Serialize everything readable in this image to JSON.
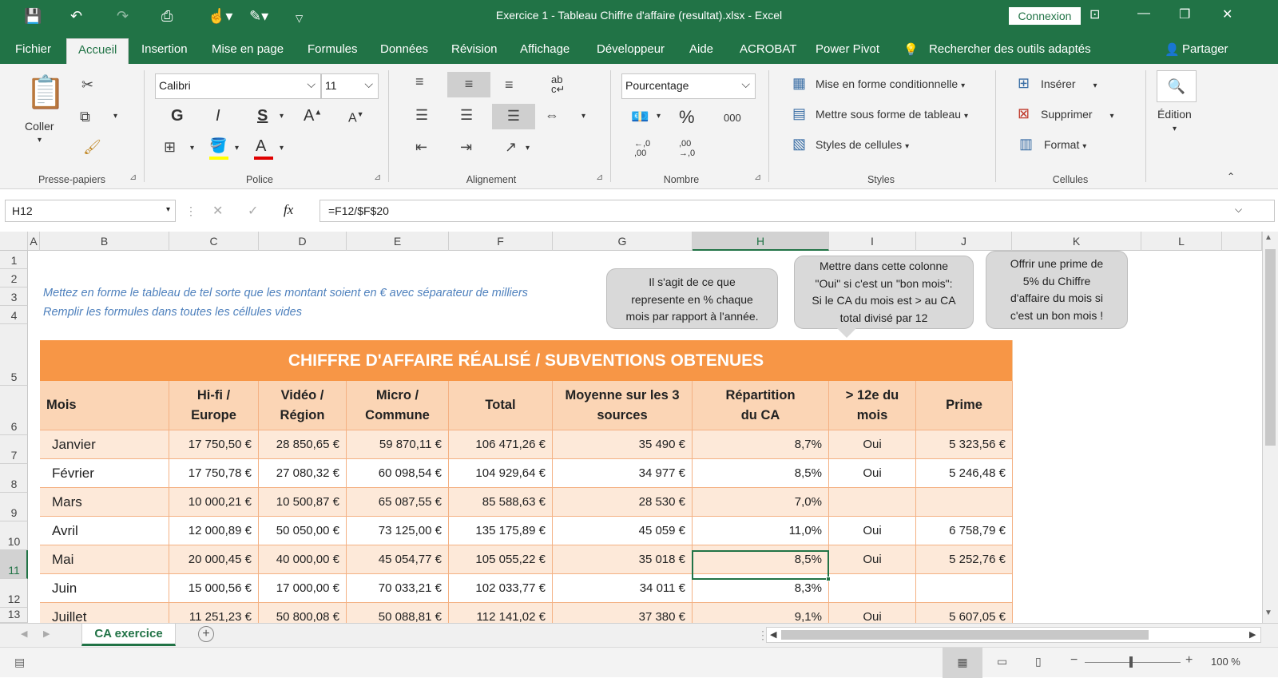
{
  "window": {
    "title": "Exercice 1 - Tableau Chiffre d'affaire (resultat).xlsx  -  Excel",
    "connexion": "Connexion"
  },
  "tabs": [
    "Fichier",
    "Accueil",
    "Insertion",
    "Mise en page",
    "Formules",
    "Données",
    "Révision",
    "Affichage",
    "Développeur",
    "Aide",
    "ACROBAT",
    "Power Pivot"
  ],
  "search": "Rechercher des outils adaptés",
  "share": "Partager",
  "ribbon": {
    "clipboard": {
      "paste": "Coller",
      "label": "Presse-papiers"
    },
    "font": {
      "name": "Calibri",
      "size": "11",
      "bold": "G",
      "italic": "I",
      "underline": "S",
      "label": "Police"
    },
    "alignment": {
      "label": "Alignement"
    },
    "number": {
      "format": "Pourcentage",
      "percent": "%",
      "thousands": "000",
      "inc": "←,0\n,00",
      "dec": ",00\n→,0",
      "label": "Nombre"
    },
    "styles": {
      "conditional": "Mise en forme conditionnelle",
      "table": "Mettre sous forme de tableau",
      "cell": "Styles de cellules",
      "label": "Styles"
    },
    "cells": {
      "insert": "Insérer",
      "delete": "Supprimer",
      "format": "Format",
      "label": "Cellules"
    },
    "editing": {
      "label": "Édition"
    }
  },
  "formula": {
    "namebox": "H12",
    "content": "=F12/$F$20"
  },
  "columns": [
    "A",
    "B",
    "C",
    "D",
    "E",
    "F",
    "G",
    "H",
    "I",
    "J",
    "K",
    "L"
  ],
  "rows": [
    "1",
    "2",
    "3",
    "4",
    "5",
    "6",
    "7",
    "8",
    "9",
    "10",
    "11",
    "12",
    "13"
  ],
  "instructions": [
    "Mettez en forme le tableau de tel sorte que les montant soient en € avec séparateur de milliers",
    "Remplir les formules dans toutes les céllules vides"
  ],
  "bubbles": [
    {
      "lines": [
        "Il s'agit de ce que",
        "represente en % chaque",
        "mois par rapport à l'année."
      ]
    },
    {
      "lines": [
        "Mettre dans cette colonne",
        "\"Oui\" si c'est un \"bon mois\":",
        "Si le CA du mois est > au CA",
        "total divisé par 12"
      ]
    },
    {
      "lines": [
        "Offrir une prime de",
        "5% du Chiffre",
        "d'affaire du mois si",
        "c'est un bon mois !"
      ]
    }
  ],
  "table": {
    "title": "CHIFFRE D'AFFAIRE RÉALISÉ / SUBVENTIONS OBTENUES",
    "headers": [
      [
        "Mois"
      ],
      [
        "Hi-fi /",
        "Europe"
      ],
      [
        "Vidéo /",
        "Région"
      ],
      [
        "Micro /",
        "Commune"
      ],
      [
        "Total"
      ],
      [
        "Moyenne sur les 3",
        "sources"
      ],
      [
        "Répartition",
        "du CA"
      ],
      [
        "> 12e du",
        "mois"
      ],
      [
        "Prime"
      ]
    ],
    "rows": [
      [
        "Janvier",
        "17 750,50 €",
        "28 850,65 €",
        "59 870,11 €",
        "106 471,26 €",
        "35 490 €",
        "8,7%",
        "Oui",
        "5 323,56 €"
      ],
      [
        "Février",
        "17 750,78 €",
        "27 080,32 €",
        "60 098,54 €",
        "104 929,64 €",
        "34 977 €",
        "8,5%",
        "Oui",
        "5 246,48 €"
      ],
      [
        "Mars",
        "10 000,21 €",
        "10 500,87 €",
        "65 087,55 €",
        "85 588,63 €",
        "28 530 €",
        "7,0%",
        "",
        ""
      ],
      [
        "Avril",
        "12 000,89 €",
        "50 050,00 €",
        "73 125,00 €",
        "135 175,89 €",
        "45 059 €",
        "11,0%",
        "Oui",
        "6 758,79 €"
      ],
      [
        "Mai",
        "20 000,45 €",
        "40 000,00 €",
        "45 054,77 €",
        "105 055,22 €",
        "35 018 €",
        "8,5%",
        "Oui",
        "5 252,76 €"
      ],
      [
        "Juin",
        "15 000,56 €",
        "17 000,00 €",
        "70 033,21 €",
        "102 033,77 €",
        "34 011 €",
        "8,3%",
        "",
        ""
      ],
      [
        "Juillet",
        "11 251,23 €",
        "50 800,08 €",
        "50 088,81 €",
        "112 141,02 €",
        "37 380 €",
        "9,1%",
        "Oui",
        "5 607,05 €"
      ]
    ]
  },
  "sheet": {
    "tab": "CA exercice"
  },
  "status": {
    "zoom": "100 %"
  }
}
